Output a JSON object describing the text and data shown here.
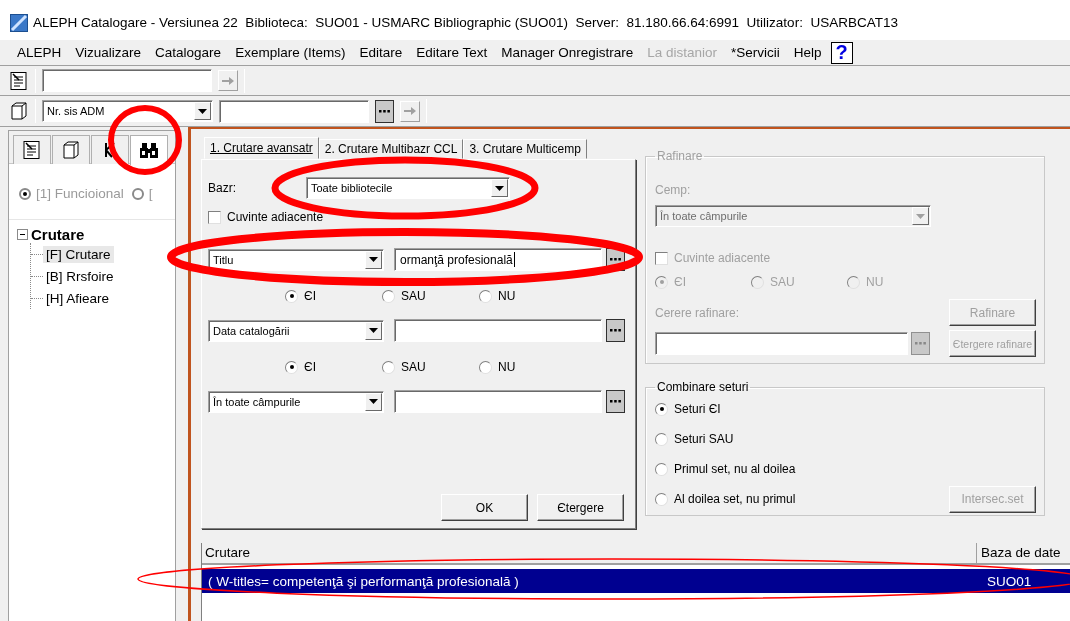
{
  "window": {
    "title": "ALEPH Catalogare - Versiunea 22  Biblioteca:  SUO01 - USMARC Bibliographic (SUO01)  Server:  81.180.66.64:6991  Utilizator:  USARBCAT13"
  },
  "menu": [
    {
      "label": "ALEPH",
      "disabled": false
    },
    {
      "label": "Vizualizare",
      "disabled": false
    },
    {
      "label": "Catalogare",
      "disabled": false
    },
    {
      "label": "Exemplare (Items)",
      "disabled": false
    },
    {
      "label": "Editare",
      "disabled": false
    },
    {
      "label": "Editare Text",
      "disabled": false
    },
    {
      "label": "Manager Onregistrare",
      "disabled": false
    },
    {
      "label": "La distanior",
      "disabled": true
    },
    {
      "label": "*Servicii",
      "disabled": false
    },
    {
      "label": "Help",
      "disabled": false
    }
  ],
  "help_button": "?",
  "toolbar": {
    "system_number_type": "Nr. sis ADM"
  },
  "sidebar": {
    "tabs": [
      {
        "kind": "record",
        "selected": false
      },
      {
        "kind": "copy",
        "selected": false
      },
      {
        "kind": "arrow",
        "selected": false
      },
      {
        "kind": "search",
        "selected": true
      }
    ],
    "modes": [
      {
        "label": "[1] Funcioional",
        "selected": true
      },
      {
        "label": "[",
        "selected": false
      }
    ],
    "tree": [
      {
        "label": "Crutare",
        "expanded": true,
        "children": [
          {
            "label": "[F] Crutare",
            "selected": true
          },
          {
            "label": "[B] Rrsfoire",
            "selected": false
          },
          {
            "label": "[H] Afieare",
            "selected": false
          }
        ]
      }
    ]
  },
  "search_tabs": [
    {
      "label": "1. Crutare avansatr",
      "selected": true
    },
    {
      "label": "2. Crutare Multibazr CCL",
      "selected": false
    },
    {
      "label": "3. Crutare Multicemp",
      "selected": false
    }
  ],
  "form": {
    "base_label": "Bazr:",
    "base": "Toate bibliotecile",
    "adjacent": {
      "label": "Cuvinte adiacente",
      "checked": false
    },
    "rows": [
      {
        "field": "Titlu",
        "value": "ormanţă profesională",
        "focused": true,
        "operators": [
          {
            "label": "ЄI",
            "selected": true
          },
          {
            "label": "SAU",
            "selected": false
          },
          {
            "label": "NU",
            "selected": false
          }
        ]
      },
      {
        "field": "Data catalogării",
        "focused": false,
        "operators": [
          {
            "label": "ЄI",
            "selected": true
          },
          {
            "label": "SAU",
            "selected": false
          },
          {
            "label": "NU",
            "selected": false
          }
        ]
      },
      {
        "field": "În toate câmpurile",
        "focused": false
      }
    ],
    "buttons": [
      "OK",
      "Єtergere"
    ]
  },
  "refine": {
    "title": "Rafinare",
    "disabled": true,
    "field_label": "Cemp:",
    "field": "În toate câmpurile",
    "adjacent": {
      "label": "Cuvinte adiacente",
      "checked": false
    },
    "operators": [
      {
        "label": "ЄI",
        "selected": true
      },
      {
        "label": "SAU",
        "selected": false
      },
      {
        "label": "NU",
        "selected": false
      }
    ],
    "request_label": "Cerere rafinare:",
    "buttons": [
      "Rafinare",
      "Єtergere rafinare"
    ]
  },
  "combine": {
    "title": "Combinare seturi",
    "options": [
      {
        "label": "Seturi ЄI",
        "selected": true
      },
      {
        "label": "Seturi SAU",
        "selected": false
      },
      {
        "label": "Primul set, nu al doilea",
        "selected": false
      },
      {
        "label": "Al doilea set, nu primul",
        "selected": false
      }
    ],
    "button": "Intersec.set",
    "button_disabled": true
  },
  "results": {
    "columns": [
      "Crutare",
      "Baza de date"
    ],
    "rows": [
      {
        "cells": [
          "( W-titles= competenţă şi performanţă profesională )",
          "SUO01"
        ],
        "selected": true
      }
    ]
  }
}
